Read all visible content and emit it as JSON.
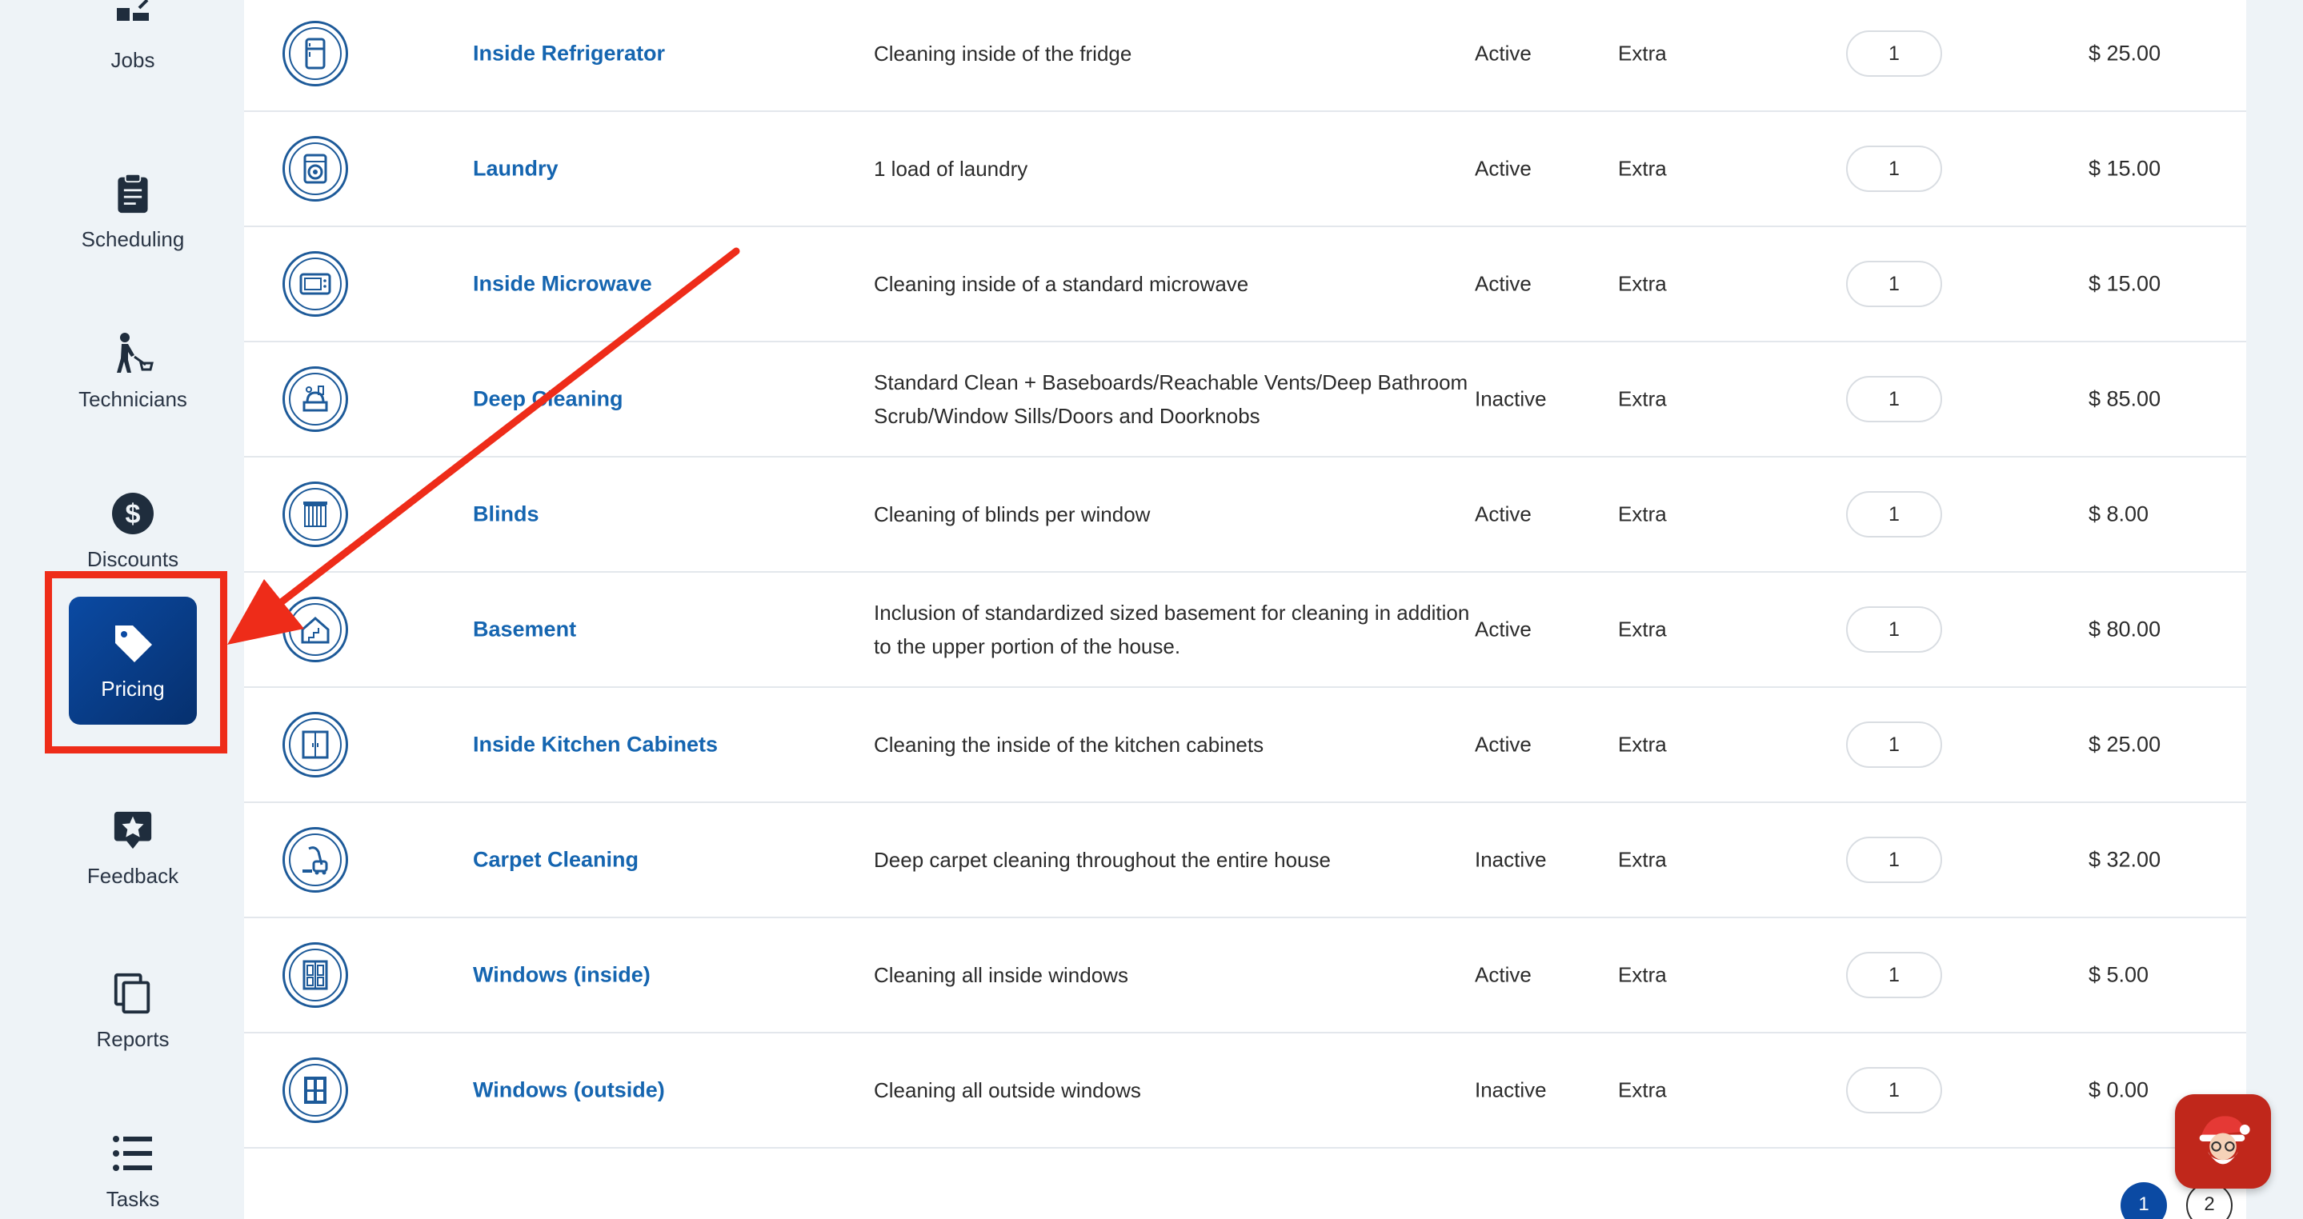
{
  "sidebar": {
    "items": [
      {
        "label": "Jobs",
        "icon": "jobs-icon"
      },
      {
        "label": "Scheduling",
        "icon": "clipboard-icon"
      },
      {
        "label": "Technicians",
        "icon": "technician-icon"
      },
      {
        "label": "Discounts",
        "icon": "dollar-icon"
      },
      {
        "label": "Pricing",
        "icon": "tag-icon",
        "active": true
      },
      {
        "label": "Feedback",
        "icon": "star-bubble-icon"
      },
      {
        "label": "Reports",
        "icon": "copy-icon"
      },
      {
        "label": "Tasks",
        "icon": "list-icon"
      }
    ]
  },
  "services": [
    {
      "name": "Inside Refrigerator",
      "description": "Cleaning inside of the fridge",
      "status": "Active",
      "type": "Extra",
      "quantity": "1",
      "price": "$ 25.00",
      "icon": "refrigerator-icon"
    },
    {
      "name": "Laundry",
      "description": "1 load of laundry",
      "status": "Active",
      "type": "Extra",
      "quantity": "1",
      "price": "$ 15.00",
      "icon": "washing-machine-icon"
    },
    {
      "name": "Inside Microwave",
      "description": "Cleaning inside of a standard microwave",
      "status": "Active",
      "type": "Extra",
      "quantity": "1",
      "price": "$ 15.00",
      "icon": "microwave-icon"
    },
    {
      "name": "Deep Cleaning",
      "description": "Standard Clean + Baseboards/Reachable Vents/Deep Bathroom Scrub/Window Sills/Doors and Doorknobs",
      "status": "Inactive",
      "type": "Extra",
      "quantity": "1",
      "price": "$ 85.00",
      "icon": "cleaning-supplies-icon"
    },
    {
      "name": "Blinds",
      "description": "Cleaning of blinds per window",
      "status": "Active",
      "type": "Extra",
      "quantity": "1",
      "price": "$ 8.00",
      "icon": "blinds-icon"
    },
    {
      "name": "Basement",
      "description": "Inclusion of standardized sized basement for cleaning in addition to the upper portion of the house.",
      "status": "Active",
      "type": "Extra",
      "quantity": "1",
      "price": "$ 80.00",
      "icon": "basement-icon"
    },
    {
      "name": "Inside Kitchen Cabinets",
      "description": "Cleaning the inside of the kitchen cabinets",
      "status": "Active",
      "type": "Extra",
      "quantity": "1",
      "price": "$ 25.00",
      "icon": "cabinet-icon"
    },
    {
      "name": "Carpet Cleaning",
      "description": "Deep carpet cleaning throughout the entire house",
      "status": "Inactive",
      "type": "Extra",
      "quantity": "1",
      "price": "$ 32.00",
      "icon": "vacuum-icon"
    },
    {
      "name": "Windows (inside)",
      "description": "Cleaning all inside windows",
      "status": "Active",
      "type": "Extra",
      "quantity": "1",
      "price": "$ 5.00",
      "icon": "window-inside-icon"
    },
    {
      "name": "Windows (outside)",
      "description": "Cleaning all outside windows",
      "status": "Inactive",
      "type": "Extra",
      "quantity": "1",
      "price": "$ 0.00",
      "icon": "window-outside-icon"
    }
  ],
  "pagination": {
    "current": "1",
    "next": "2"
  },
  "colors": {
    "accent": "#0b4aa3",
    "link": "#1565b0",
    "annotation": "#ee2c19"
  }
}
